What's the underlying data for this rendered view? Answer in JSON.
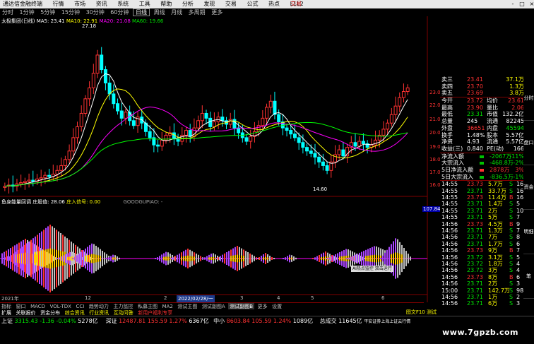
{
  "menubar": {
    "logo": "通达信金融终端",
    "items": [
      "行情",
      "市场",
      "资讯",
      "系统",
      "工具",
      "帮助",
      "分析",
      "发现",
      "交易",
      "公式",
      "热点",
      "L1L2"
    ],
    "brand": "交易",
    "win_buttons": [
      "-",
      "□",
      "×"
    ]
  },
  "timeframes": [
    "分时",
    "1分钟",
    "5分钟",
    "15分钟",
    "30分钟",
    "60分钟",
    "日线",
    "周线",
    "月线",
    "多周期",
    "更多"
  ],
  "timeframe_active": "日线",
  "ma_header": {
    "name": "太极集团(日线)",
    "ma5": "MA5: 23.41",
    "ma10": "MA10: 22.91",
    "ma20": "MA20: 21.08",
    "ma60": "MA60: 19.66",
    "colors": {
      "ma5": "#ffffff",
      "ma10": "#ffff00",
      "ma20": "#ff00ff",
      "ma60": "#00ff00"
    }
  },
  "price_axis": [
    "23.00",
    "22.00",
    "21.00",
    "20.00",
    "19.00",
    "18.00",
    "17.00",
    "16.00"
  ],
  "annotations": {
    "high": "27.18",
    "low": "14.60",
    "right_axis_value": "107.84"
  },
  "indicator_header": {
    "title": "鱼身能量回调",
    "label1": "庄股值: 28.06",
    "label2": "庄入信号: 0.00",
    "label3": "GOODGUPIAO: -"
  },
  "indicator_tooltip": {
    "line1": "AI热点监控",
    "line2": "双击运行"
  },
  "x_axis": {
    "year": "2021年",
    "months": [
      "12",
      "2",
      "3",
      "4",
      "5",
      "6"
    ],
    "cursor_date": "2022/02/28/一"
  },
  "quote": {
    "ask": [
      {
        "label": "卖三",
        "price": "23.41",
        "vol": "37.1万"
      },
      {
        "label": "卖四",
        "price": "23.70",
        "vol": "1.3万"
      },
      {
        "label": "卖五",
        "price": "23.69",
        "vol": "3.8万"
      }
    ],
    "stats": [
      {
        "l1": "今开",
        "v1": "23.72",
        "l2": "均价",
        "v2": "23.61",
        "c1": "red",
        "c2": "red"
      },
      {
        "l1": "最高",
        "v1": "23.90",
        "l2": "量比",
        "v2": "2.06",
        "c1": "red",
        "c2": "red"
      },
      {
        "l1": "最低",
        "v1": "23.31",
        "l2": "市值",
        "v2": "132.2亿",
        "c1": "green",
        "c2": "white"
      },
      {
        "l1": "总量",
        "v1": "245",
        "l2": "流通",
        "v2": "82245",
        "c1": "white",
        "c2": "white"
      },
      {
        "l1": "外盘",
        "v1": "36651",
        "l2": "内盘",
        "v2": "45594",
        "c1": "red",
        "c2": "green"
      },
      {
        "l1": "换手",
        "v1": "1.48%",
        "l2": "股本",
        "v2": "5.57亿",
        "c1": "white",
        "c2": "white"
      },
      {
        "l1": "净资",
        "v1": "4.93",
        "l2": "流通",
        "v2": "5.57亿",
        "c1": "white",
        "c2": "white"
      },
      {
        "l1": "收益(三)",
        "v1": "0.840",
        "l2": "PE(动)",
        "v2": "166",
        "c1": "white",
        "c2": "white"
      }
    ],
    "flows": [
      {
        "label": "净流入额",
        "value": "-2067万",
        "pct": "-11%",
        "c": "green"
      },
      {
        "label": "大宗流入",
        "value": "-468.8万",
        "pct": "-2%",
        "c": "green"
      },
      {
        "label": "5日净流入额",
        "value": "2878万",
        "pct": "3%",
        "c": "red"
      },
      {
        "label": "5日大宗流入",
        "value": "-836.5万",
        "pct": "-1%",
        "c": "green"
      }
    ],
    "ticks": [
      {
        "t": "14:55",
        "p": "23.73",
        "v": "5.7万",
        "s": "S",
        "n": "16"
      },
      {
        "t": "14:55",
        "p": "23.71",
        "v": "33.7万",
        "s": "S",
        "n": "16"
      },
      {
        "t": "14:55",
        "p": "23.73",
        "v": "11.4万",
        "s": "B",
        "n": "16"
      },
      {
        "t": "14:55",
        "p": "23.71",
        "v": "1.4万",
        "s": "S",
        "n": "5"
      },
      {
        "t": "14:55",
        "p": "23.71",
        "v": "2万",
        "s": "S",
        "n": "10"
      },
      {
        "t": "14:55",
        "p": "23.71",
        "v": "5万",
        "s": "S",
        "n": "7"
      },
      {
        "t": "14:56",
        "p": "23.73",
        "v": "4.5万",
        "s": "B",
        "n": "9"
      },
      {
        "t": "14:56",
        "p": "23.71",
        "v": "1.3万",
        "s": "S",
        "n": "7"
      },
      {
        "t": "14:56",
        "p": "23.71",
        "v": "7万",
        "s": "S",
        "n": "8"
      },
      {
        "t": "14:56",
        "p": "23.71",
        "v": "1.7万",
        "s": "S",
        "n": "6"
      },
      {
        "t": "14:56",
        "p": "23.73",
        "v": "9万",
        "s": "B",
        "n": "7"
      },
      {
        "t": "14:56",
        "p": "23.72",
        "v": "3.1万",
        "s": "S",
        "n": "5"
      },
      {
        "t": "14:56",
        "p": "23.72",
        "v": "1.8万",
        "s": "S",
        "n": "4"
      },
      {
        "t": "14:56",
        "p": "23.72",
        "v": "3万",
        "s": "S",
        "n": "4"
      },
      {
        "t": "14:56",
        "p": "23.73",
        "v": "8万",
        "s": "B",
        "n": "6"
      },
      {
        "t": "14:56",
        "p": "23.71",
        "v": "2万",
        "s": "S",
        "n": "3"
      },
      {
        "t": "15:00",
        "p": "23.71",
        "v": "142.7万",
        "s": "S",
        "n": "98"
      },
      {
        "t": "14:56",
        "p": "23.71",
        "v": "1万",
        "s": "S",
        "n": "2"
      },
      {
        "t": "14:56",
        "p": "23.71",
        "v": "6万",
        "s": "S",
        "n": "3"
      }
    ]
  },
  "vbar": [
    "分时",
    "盘口",
    "资金",
    "明细",
    "笔"
  ],
  "tabs": [
    "指标",
    "窗口",
    "MACD",
    "VOL-TDX",
    "CCI",
    "趋势动力",
    "主力监控",
    "私募主图",
    "MA2",
    "测试主图",
    "测试副图A",
    "测试副图B",
    "更多",
    "设置"
  ],
  "tabs_active": "测试副图B",
  "subtabs": [
    "扩展",
    "关联报价",
    "资金分布",
    "综合资讯",
    "行业资讯",
    "互动问答",
    "新用户福利专享"
  ],
  "subtabs_right": "图文F10 测试",
  "status": [
    {
      "name": "上证",
      "value": "3315.43",
      "chg": "-1.36",
      "pct": "-0.04%",
      "amt": "5278亿",
      "c": "green"
    },
    {
      "name": "深证",
      "value": "12487.81",
      "chg": "155.59",
      "pct": "1.27%",
      "amt": "6367亿",
      "c": "red"
    },
    {
      "name": "中小",
      "value": "8603.84",
      "chg": "105.59",
      "pct": "1.24%",
      "amt": "1089亿",
      "c": "red"
    }
  ],
  "status_extra": {
    "label": "总成交",
    "value": "11645亿",
    "note": "平安证券上海上证云行情"
  },
  "watermark": "www.7gpzb.com"
}
